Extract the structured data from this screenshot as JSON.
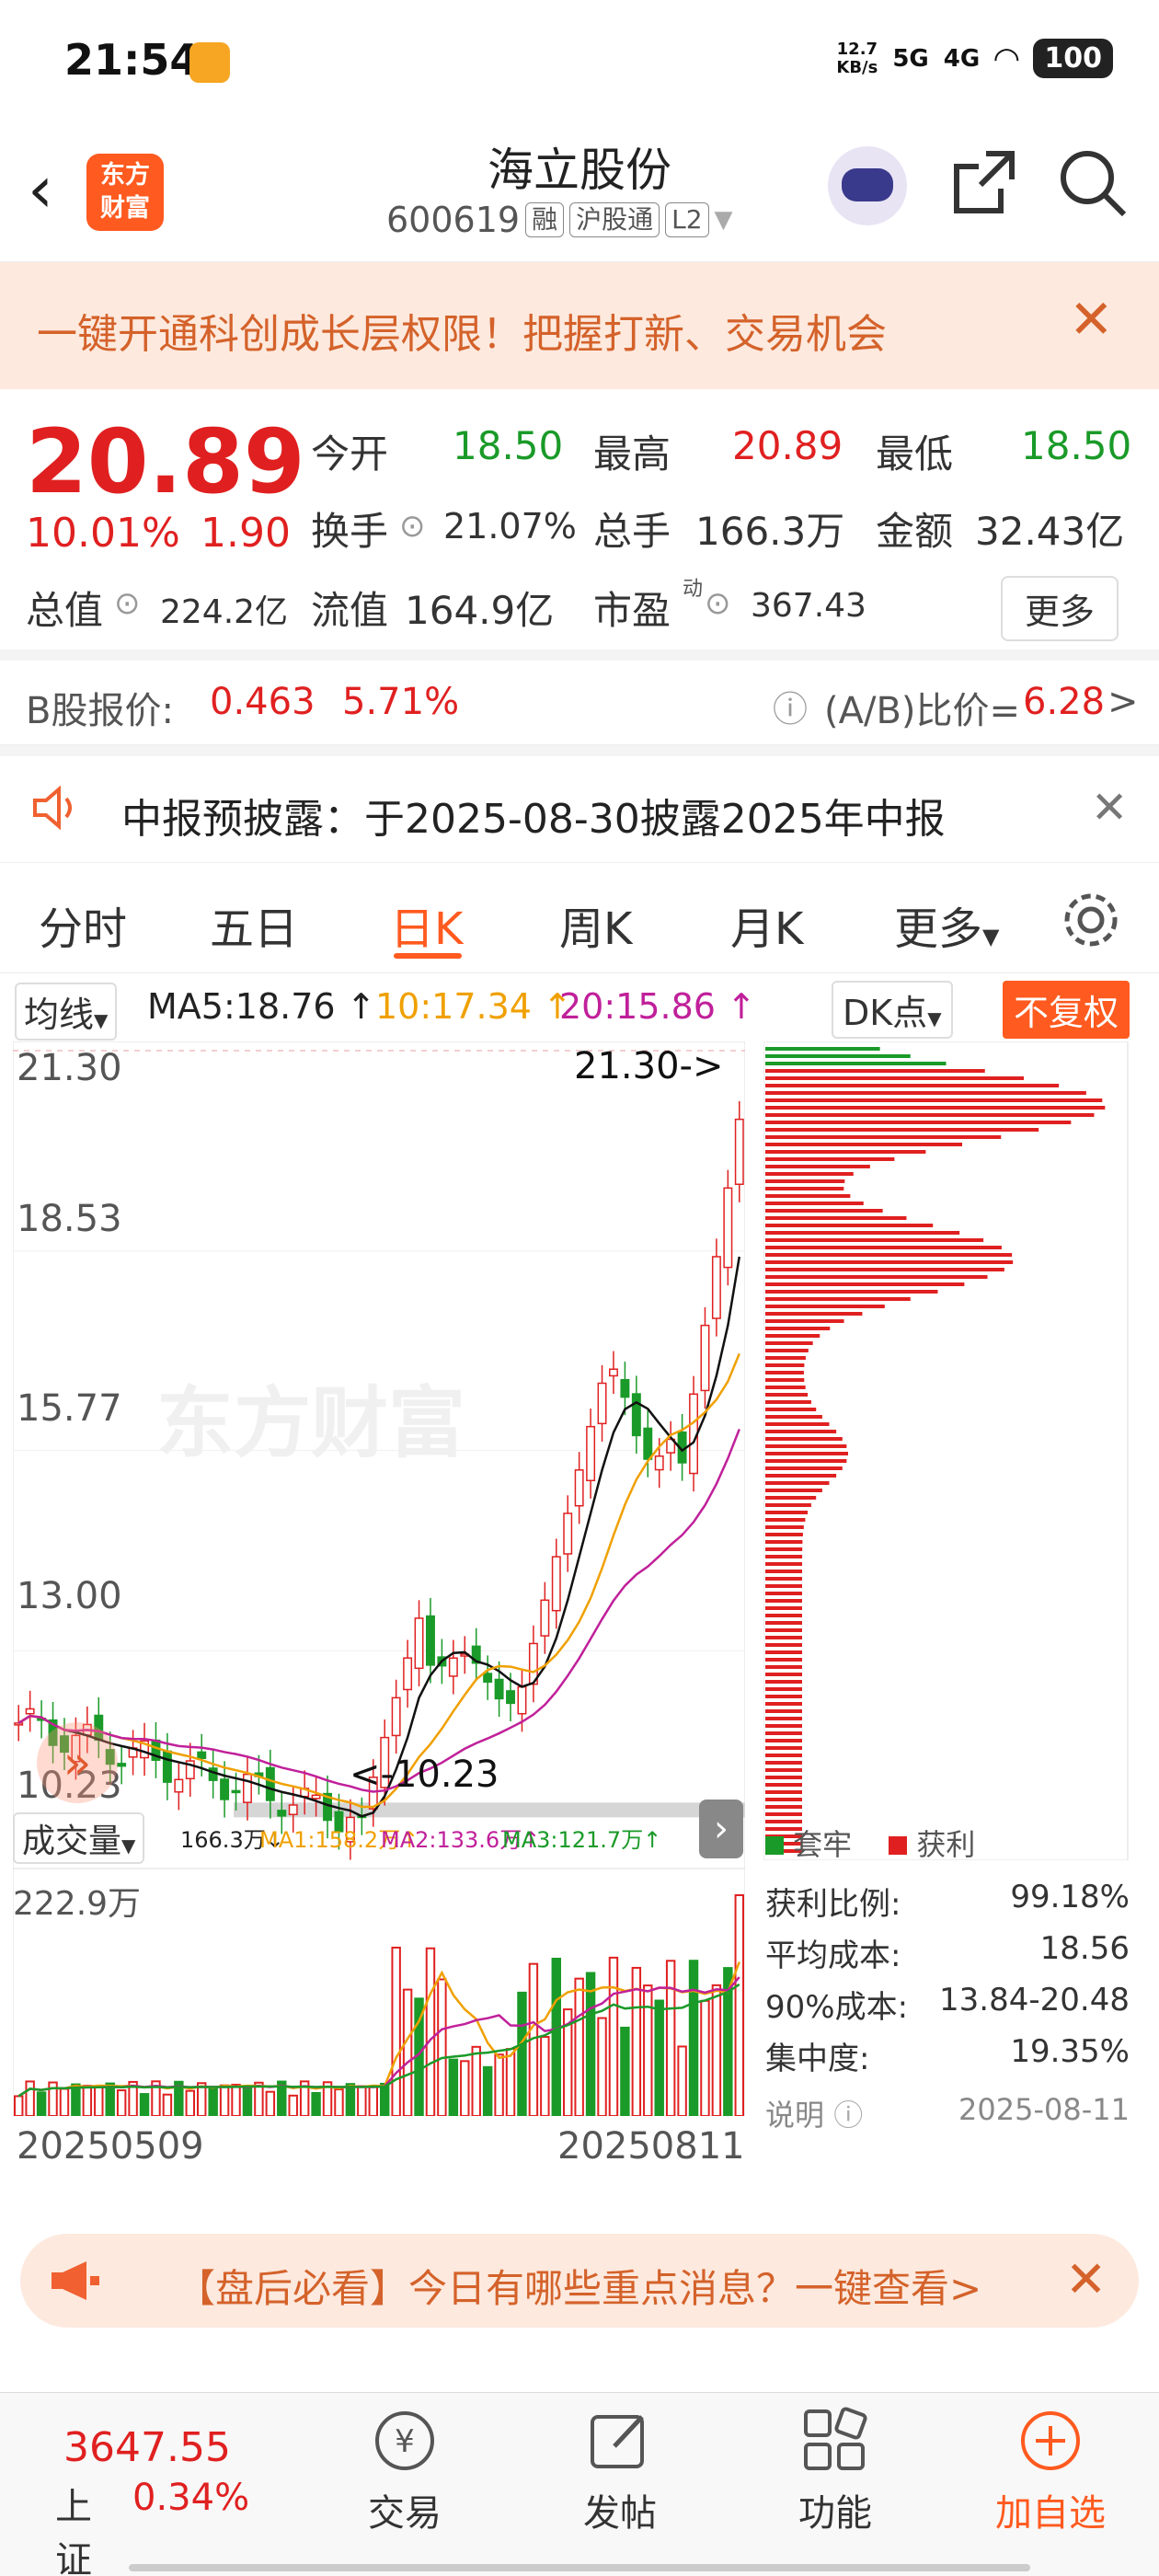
{
  "status_bar": {
    "time": "21:54",
    "net_speed": "12.7\nKB/s",
    "net_speed_top": "12.7",
    "net_speed_bottom": "KB/s",
    "sig1": "5G",
    "sig2": "4G",
    "battery": "100"
  },
  "header": {
    "title": "海立股份",
    "code": "600619",
    "tag_rong": "融",
    "tag_hgt": "沪股通",
    "tag_l2": "L2",
    "logo_line1": "东方",
    "logo_line2": "财富"
  },
  "banner": {
    "text": "一键开通科创成长层权限！把握打新、交易机会"
  },
  "quote": {
    "price": "20.89",
    "change_pct": "10.01%",
    "change_amt": "1.90",
    "open_label": "今开",
    "open": "18.50",
    "high_label": "最高",
    "high": "20.89",
    "low_label": "最低",
    "low": "18.50",
    "turnover_label": "换手",
    "turnover": "21.07%",
    "volume_label": "总手",
    "volume": "166.3万",
    "amount_label": "金额",
    "amount": "32.43亿",
    "mcap_label": "总值",
    "mcap": "224.2亿",
    "float_label": "流值",
    "float": "164.9亿",
    "pe_label": "市盈",
    "pe_sup": "动",
    "pe": "367.43",
    "more": "更多"
  },
  "bshare": {
    "label": "B股报价:",
    "price": "0.463",
    "pct": "5.71%",
    "ratio_label": "(A/B)比价=",
    "ratio": "6.28",
    "arrow": ">"
  },
  "notice": {
    "text": "中报预披露：于2025-08-30披露2025年中报"
  },
  "tabs": [
    "分时",
    "五日",
    "日K",
    "周K",
    "月K",
    "更多"
  ],
  "kline": {
    "ma_select": "均线",
    "ma5": "MA5:18.76 ↑",
    "ma10": "10:17.34 ↑",
    "ma20": "20:15.86 ↑",
    "dk": "DK点",
    "adjust": "不复权",
    "y_labels": [
      "21.30",
      "18.53",
      "15.77",
      "13.00",
      "10.23"
    ],
    "max_marker": "21.30->",
    "min_marker": "<-10.23",
    "watermark": "东方财富",
    "vol_select": "成交量",
    "vol_val": "166.3万↓",
    "vol_ma1": "MA1:158.2万↑",
    "vol_ma2": "MA2:133.6万↑",
    "vol_ma3": "MA3:121.7万↑",
    "vol_max": "222.9万",
    "date_start": "20250509",
    "date_end": "20250811"
  },
  "chips": {
    "legend_trap": "套牢",
    "legend_profit": "获利",
    "rows": [
      {
        "label": "获利比例:",
        "value": "99.18%"
      },
      {
        "label": "平均成本:",
        "value": "18.56"
      },
      {
        "label": "90%成本:",
        "value": "13.84-20.48"
      },
      {
        "label": "集中度:",
        "value": "19.35%"
      }
    ],
    "note_label": "说明",
    "date": "2025-08-11"
  },
  "ad": {
    "text": "【盘后必看】今日有哪些重点消息？一键查看>"
  },
  "bottom_nav": {
    "index_value": "3647.55",
    "index_name": "上证",
    "index_pct": "0.34%",
    "items": [
      "交易",
      "发帖",
      "功能",
      "加自选"
    ]
  },
  "colors": {
    "red": "#e02020",
    "green": "#1a9a28",
    "accent": "#ff5a1f",
    "banner_bg": "#fde9de"
  }
}
